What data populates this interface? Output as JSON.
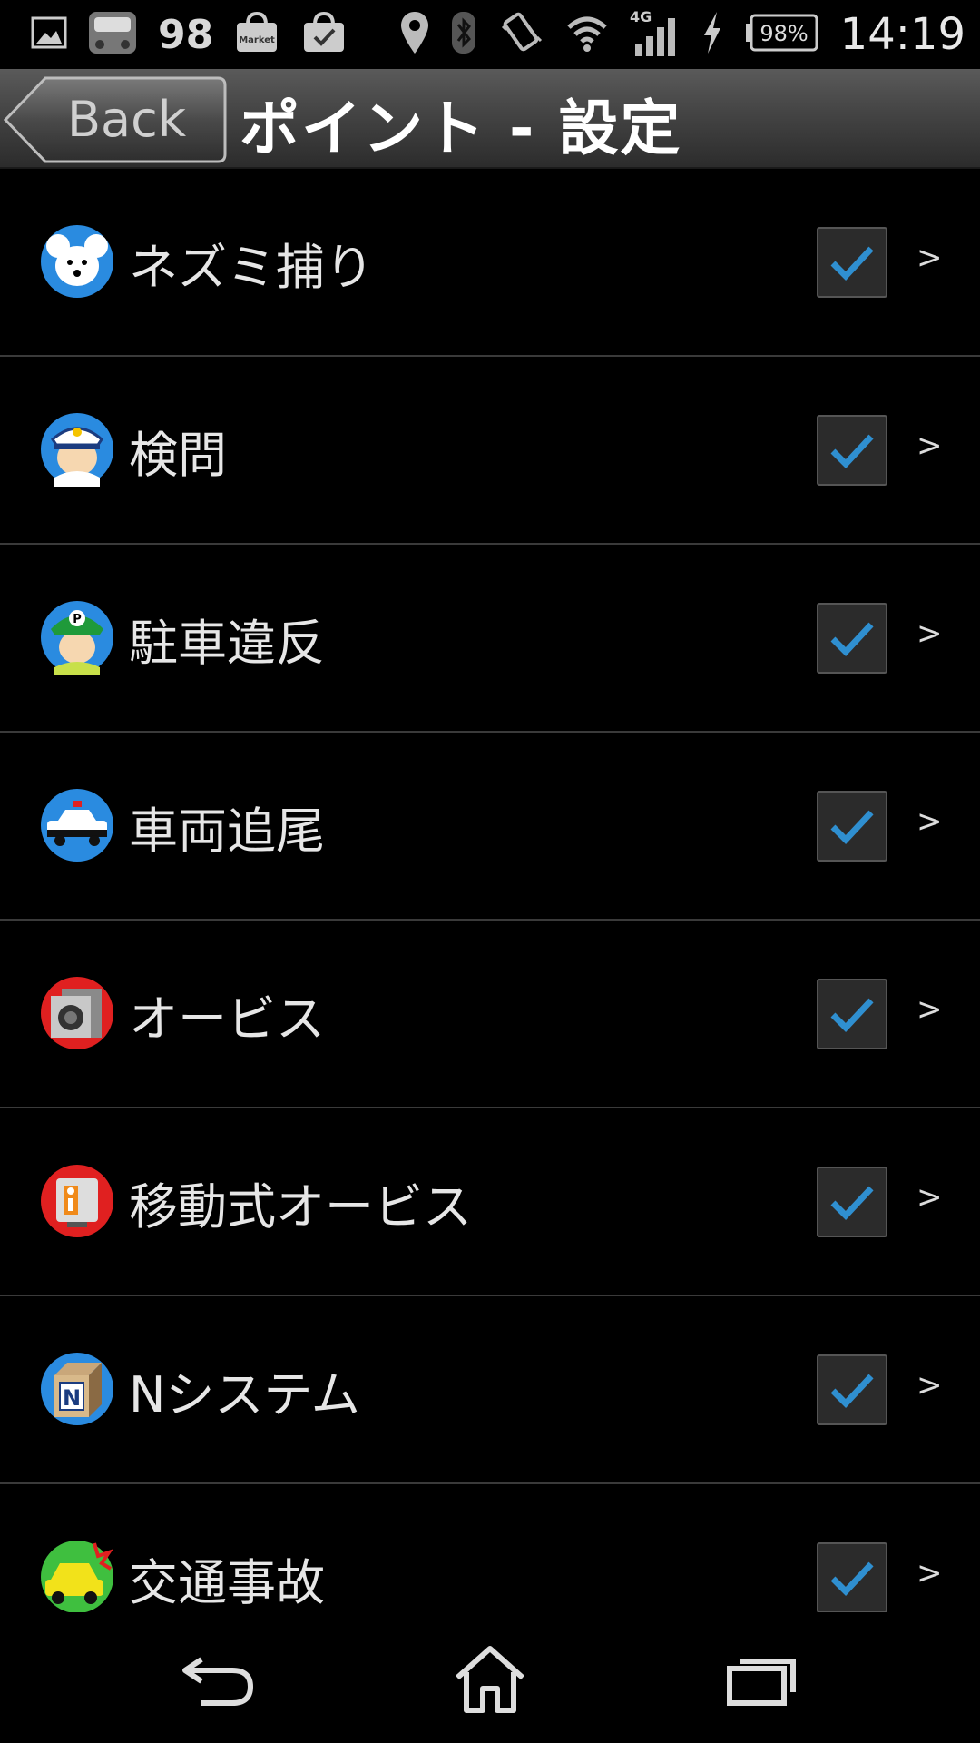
{
  "status_bar": {
    "notification_count": "98",
    "market_label": "Market",
    "battery": "98%",
    "network": "4G",
    "time": "14:19"
  },
  "header": {
    "back_label": "Back",
    "title": "ポイント - 設定"
  },
  "items": [
    {
      "label": "ネズミ捕り",
      "icon": "mouse-icon",
      "checked": true
    },
    {
      "label": "検問",
      "icon": "police-officer-icon",
      "checked": true
    },
    {
      "label": "駐車違反",
      "icon": "parking-officer-icon",
      "checked": true
    },
    {
      "label": "車両追尾",
      "icon": "police-car-icon",
      "checked": true
    },
    {
      "label": "オービス",
      "icon": "speed-camera-icon",
      "checked": true
    },
    {
      "label": "移動式オービス",
      "icon": "mobile-speed-camera-icon",
      "checked": true
    },
    {
      "label": "Nシステム",
      "icon": "n-system-icon",
      "checked": true
    },
    {
      "label": "交通事故",
      "icon": "accident-icon",
      "checked": true
    }
  ],
  "chevron": ">",
  "colors": {
    "check": "#2f8fd0",
    "header_top": "#5a5a5a",
    "divider": "#3a3a3a"
  }
}
